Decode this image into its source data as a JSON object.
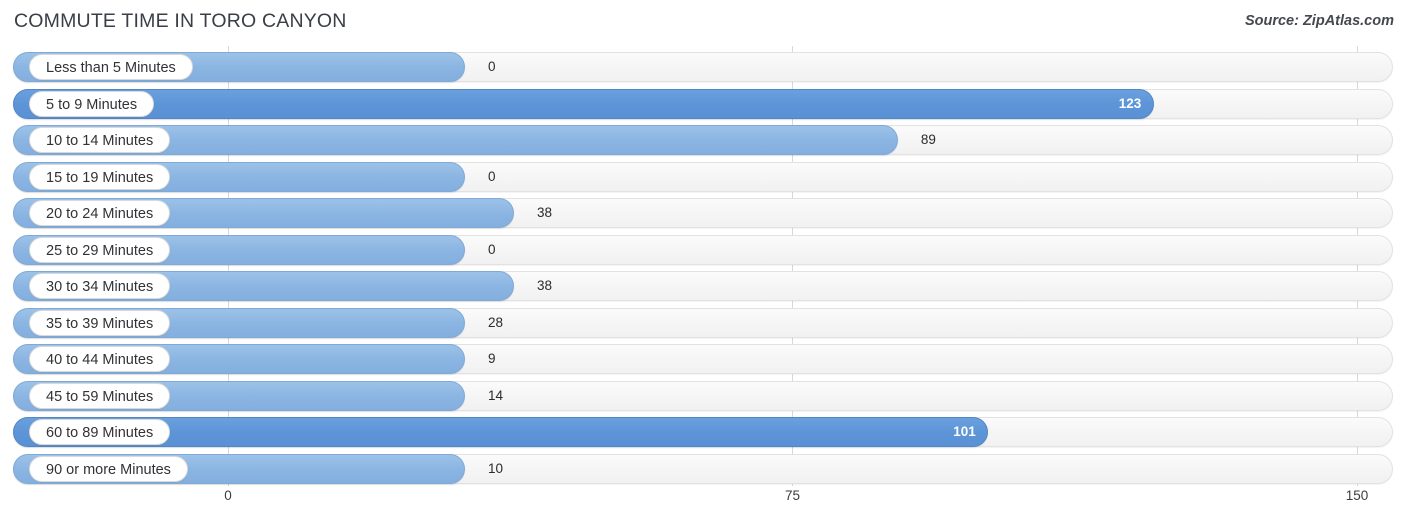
{
  "header": {
    "title": "COMMUTE TIME IN TORO CANYON",
    "source": "Source: ZipAtlas.com"
  },
  "colors": {
    "bar_light": "#8bb5e2",
    "bar_dark": "#5d95d8",
    "track": "#f5f5f5",
    "gridline": "#d8d8d8",
    "value_inside": "#ffffff",
    "value_outside": "#2b2b2b",
    "title": "#3a3f47"
  },
  "axis": {
    "ticks": [
      "0",
      "75",
      "150"
    ],
    "min": 0,
    "max": 150
  },
  "chart_data": {
    "type": "bar",
    "orientation": "horizontal",
    "title": "COMMUTE TIME IN TORO CANYON",
    "subtitle": "Source: ZipAtlas.com",
    "xlabel": "",
    "ylabel": "",
    "xlim": [
      0,
      150
    ],
    "xticks": [
      0,
      75,
      150
    ],
    "grid": true,
    "legend": "none",
    "categories": [
      "Less than 5 Minutes",
      "5 to 9 Minutes",
      "10 to 14 Minutes",
      "15 to 19 Minutes",
      "20 to 24 Minutes",
      "25 to 29 Minutes",
      "30 to 34 Minutes",
      "35 to 39 Minutes",
      "40 to 44 Minutes",
      "45 to 59 Minutes",
      "60 to 89 Minutes",
      "90 or more Minutes"
    ],
    "values": [
      0,
      123,
      89,
      0,
      38,
      0,
      38,
      28,
      9,
      14,
      101,
      10
    ],
    "value_labels": [
      "0",
      "123",
      "89",
      "0",
      "38",
      "0",
      "38",
      "28",
      "9",
      "14",
      "101",
      "10"
    ]
  },
  "bars": [
    {
      "label": "Less than 5 Minutes",
      "value": 0,
      "value_label": "0",
      "shade": "light",
      "inside": false
    },
    {
      "label": "5 to 9 Minutes",
      "value": 123,
      "value_label": "123",
      "shade": "dark",
      "inside": true
    },
    {
      "label": "10 to 14 Minutes",
      "value": 89,
      "value_label": "89",
      "shade": "light",
      "inside": false
    },
    {
      "label": "15 to 19 Minutes",
      "value": 0,
      "value_label": "0",
      "shade": "light",
      "inside": false
    },
    {
      "label": "20 to 24 Minutes",
      "value": 38,
      "value_label": "38",
      "shade": "light",
      "inside": false
    },
    {
      "label": "25 to 29 Minutes",
      "value": 0,
      "value_label": "0",
      "shade": "light",
      "inside": false
    },
    {
      "label": "30 to 34 Minutes",
      "value": 38,
      "value_label": "38",
      "shade": "light",
      "inside": false
    },
    {
      "label": "35 to 39 Minutes",
      "value": 28,
      "value_label": "28",
      "shade": "light",
      "inside": false
    },
    {
      "label": "40 to 44 Minutes",
      "value": 9,
      "value_label": "9",
      "shade": "light",
      "inside": false
    },
    {
      "label": "45 to 59 Minutes",
      "value": 14,
      "value_label": "14",
      "shade": "light",
      "inside": false
    },
    {
      "label": "60 to 89 Minutes",
      "value": 101,
      "value_label": "101",
      "shade": "dark",
      "inside": true
    },
    {
      "label": "90 or more Minutes",
      "value": 10,
      "value_label": "10",
      "shade": "light",
      "inside": false
    }
  ]
}
